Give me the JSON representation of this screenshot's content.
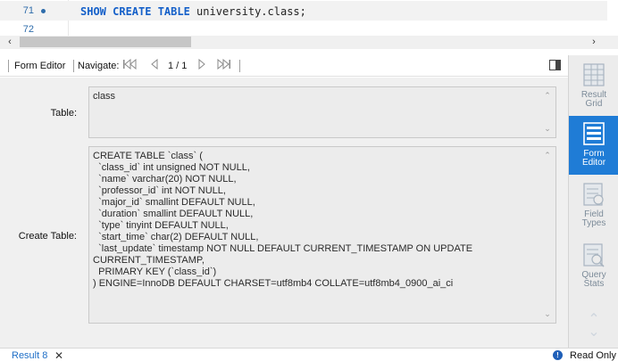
{
  "editor": {
    "lines": [
      {
        "number": "71",
        "keywords": "SHOW CREATE TABLE",
        "rest": " university.class;"
      },
      {
        "number": "72"
      }
    ]
  },
  "toolbar": {
    "form_editor_label": "Form Editor",
    "navigate_label": "Navigate:",
    "page_indicator": "1 / 1"
  },
  "form": {
    "table_label": "Table:",
    "table_value": "class",
    "create_table_label": "Create Table:",
    "create_table_value": "CREATE TABLE `class` (\n  `class_id` int unsigned NOT NULL,\n  `name` varchar(20) NOT NULL,\n  `professor_id` int NOT NULL,\n  `major_id` smallint DEFAULT NULL,\n  `duration` smallint DEFAULT NULL,\n  `type` tinyint DEFAULT NULL,\n  `start_time` char(2) DEFAULT NULL,\n  `last_update` timestamp NOT NULL DEFAULT CURRENT_TIMESTAMP ON UPDATE\nCURRENT_TIMESTAMP,\n  PRIMARY KEY (`class_id`)\n) ENGINE=InnoDB DEFAULT CHARSET=utf8mb4 COLLATE=utf8mb4_0900_ai_ci"
  },
  "sidepanel": {
    "items": [
      {
        "label_line1": "Result",
        "label_line2": "Grid",
        "icon": "result-grid-icon"
      },
      {
        "label_line1": "Form",
        "label_line2": "Editor",
        "icon": "form-editor-icon",
        "active": true
      },
      {
        "label_line1": "Field",
        "label_line2": "Types",
        "icon": "field-types-icon"
      },
      {
        "label_line1": "Query",
        "label_line2": "Stats",
        "icon": "query-stats-icon"
      }
    ]
  },
  "status": {
    "result_tab": "Result 8",
    "close_glyph": "✕",
    "read_only": "Read Only",
    "info_glyph": "!"
  },
  "colors": {
    "accent": "#1f7cd6",
    "keyword": "#1560c9",
    "line_number": "#2e6cab"
  }
}
